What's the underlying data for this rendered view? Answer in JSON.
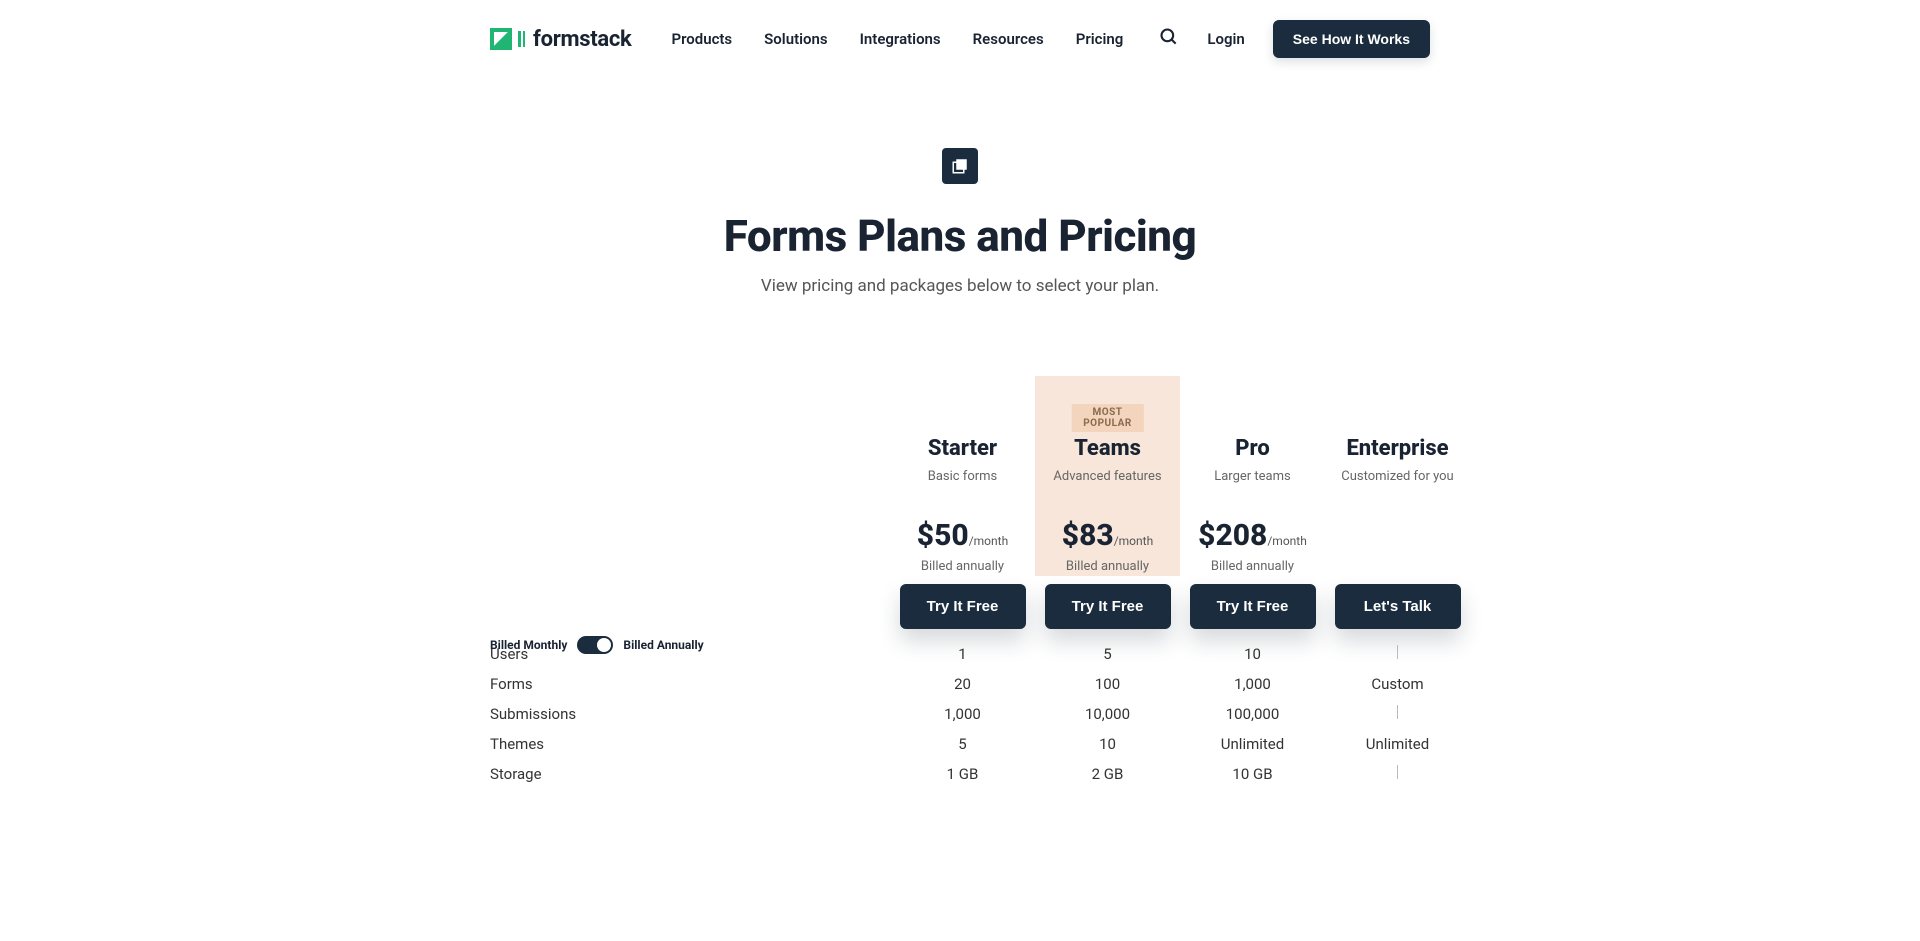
{
  "header": {
    "brand": "formstack",
    "nav": {
      "products": "Products",
      "solutions": "Solutions",
      "integrations": "Integrations",
      "resources": "Resources",
      "pricing": "Pricing"
    },
    "login": "Login",
    "cta": "See How It Works"
  },
  "hero": {
    "title": "Forms Plans and Pricing",
    "subtitle": "View pricing and packages below to select your plan."
  },
  "billing_toggle": {
    "monthly": "Billed Monthly",
    "annually": "Billed Annually"
  },
  "popular_label": "MOST POPULAR",
  "plans": [
    {
      "name": "Starter",
      "desc": "Basic forms",
      "price": "$50",
      "suffix": "/month",
      "billing": "Billed annually",
      "cta": "Try It Free"
    },
    {
      "name": "Teams",
      "desc": "Advanced features",
      "price": "$83",
      "suffix": "/month",
      "billing": "Billed annually",
      "cta": "Try It Free",
      "popular": true
    },
    {
      "name": "Pro",
      "desc": "Larger teams",
      "price": "$208",
      "suffix": "/month",
      "billing": "Billed annually",
      "cta": "Try It Free"
    },
    {
      "name": "Enterprise",
      "desc": "Customized for you",
      "price": "",
      "suffix": "",
      "billing": "",
      "cta": "Let's Talk"
    }
  ],
  "features": [
    {
      "label": "Users",
      "values": [
        "1",
        "5",
        "10",
        ""
      ]
    },
    {
      "label": "Forms",
      "values": [
        "20",
        "100",
        "1,000",
        "Custom"
      ]
    },
    {
      "label": "Submissions",
      "values": [
        "1,000",
        "10,000",
        "100,000",
        ""
      ]
    },
    {
      "label": "Themes",
      "values": [
        "5",
        "10",
        "Unlimited",
        "Unlimited"
      ]
    },
    {
      "label": "Storage",
      "values": [
        "1 GB",
        "2 GB",
        "10 GB",
        ""
      ]
    }
  ]
}
